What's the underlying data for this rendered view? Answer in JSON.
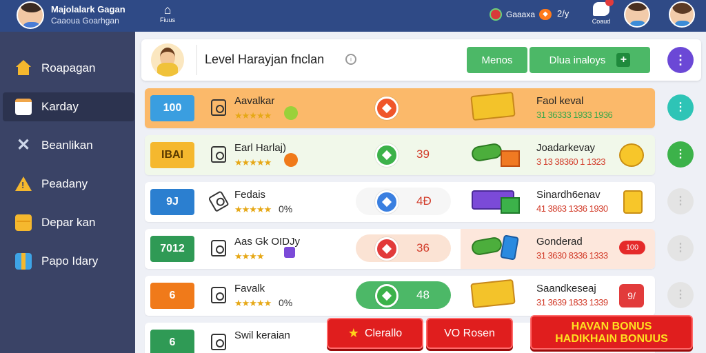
{
  "topbar": {
    "title": "Majolalark Gagan",
    "subtitle": "Caaoua Goarhgan",
    "home_label": "Fiuus",
    "status_text": "Gaaaxa",
    "count": "2/y",
    "notif_label": "Coaud"
  },
  "sidebar": {
    "items": [
      {
        "label": "Roapagan",
        "icon": "home-icon"
      },
      {
        "label": "Karday",
        "icon": "calendar-icon"
      },
      {
        "label": "Beanlikan",
        "icon": "x-icon"
      },
      {
        "label": "Peadany",
        "icon": "warning-icon"
      },
      {
        "label": "Depar kan",
        "icon": "folder-icon"
      },
      {
        "label": "Papo Idary",
        "icon": "gift-icon"
      }
    ]
  },
  "header": {
    "title": "Level Harayjan fnclan",
    "btn1": "Menos",
    "btn2": "Dlua inaloys"
  },
  "rows": [
    {
      "badge": "100",
      "badge_color": "#3a9ee0",
      "name": "Aavalkar",
      "stars": "★★★★★",
      "pct": "",
      "dot_color": "#f0562a",
      "score": "",
      "prize": "Faol keval",
      "odds": "31 36333 1933 1936",
      "row_tint": "#fbb96a",
      "action_color": "#2ec4b6"
    },
    {
      "badge": "IBAI",
      "badge_color": "#f5b82e",
      "name": "Earl Harlaj)",
      "stars": "★★★★★",
      "pct": "",
      "dot_color": "#3cb24a",
      "score": "39",
      "prize": "Joadarkevay",
      "odds": "3 13 38360 1 1323",
      "row_tint": "#eef7e6",
      "action_color": "#3cb24a"
    },
    {
      "badge": "9J",
      "badge_color": "#2b7fd0",
      "name": "Fedais",
      "stars": "★★★★★",
      "pct": "0%",
      "dot_color": "#3a7fe0",
      "score": "4Đ",
      "prize": "Sinardh6enav",
      "odds": "41 3863 1336 1930",
      "row_tint": "#ffffff",
      "action_color": "#dcdcdc"
    },
    {
      "badge": "7012",
      "badge_color": "#2f9a55",
      "name": "Aas Gk OIDJy",
      "stars": "★★★★",
      "pct": "",
      "dot_color": "#e23b3b",
      "score": "36",
      "prize": "Gonderad",
      "odds": "31 3630 8336 1333",
      "row_tint": "#fde7dc",
      "action_color": "#dcdcdc"
    },
    {
      "badge": "6",
      "badge_color": "#f07a1a",
      "name": "Favalk",
      "stars": "★★★★★",
      "pct": "0%",
      "dot_color": "#3cb24a",
      "score": "48",
      "prize": "Saandkeseaj",
      "odds": "31 3639 1833 1339",
      "row_tint": "#ffffff",
      "action_color": "#dcdcdc"
    },
    {
      "badge": "6",
      "badge_color": "#2f9a55",
      "name": "Swil keraian",
      "stars": "",
      "pct": "",
      "dot_color": "",
      "score": "",
      "prize": "",
      "odds": "",
      "row_tint": "#ffffff",
      "action_color": ""
    }
  ],
  "side_extras": {
    "row4_badge": "100",
    "row5_badge": "9/"
  },
  "footer": {
    "btn1": "Clerallo",
    "btn2": "VO Rosen",
    "bonus_line1": "HAVAN BONUS",
    "bonus_line2": "HADIKHAIN BONUUS"
  },
  "colors": {
    "topbar": "#2f4a86",
    "sidebar": "#3a4366",
    "accent_green": "#4cb867",
    "accent_red": "#e01e1e",
    "accent_purple": "#6b48d6"
  }
}
